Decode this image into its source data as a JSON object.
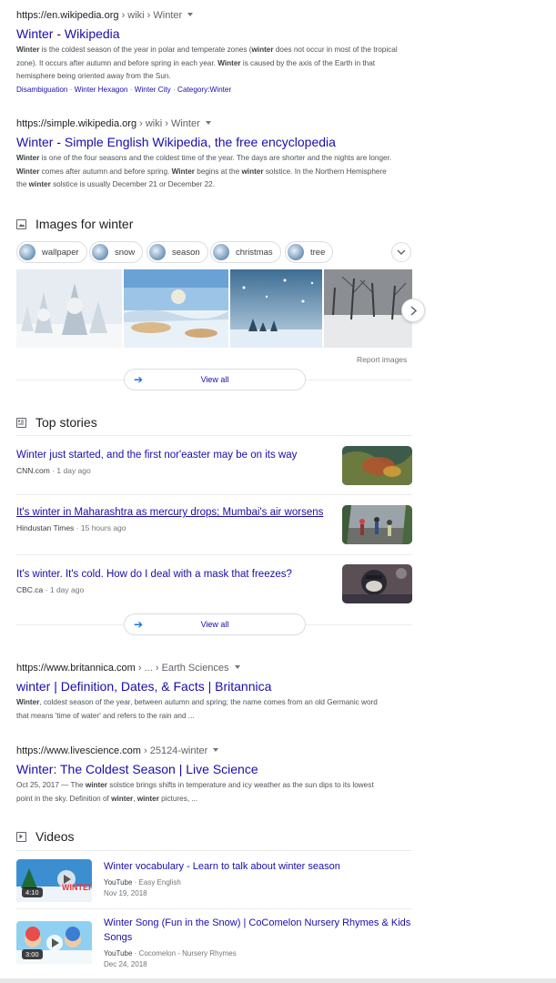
{
  "results": [
    {
      "domain": "https://en.wikipedia.org",
      "path": " › wiki › Winter",
      "title": "Winter - Wikipedia",
      "snippet_html": "<b>Winter</b> is the coldest season of the year in polar and temperate zones (<b>winter</b> does not occur in most of the tropical zone). It occurs after autumn and before spring in each year. <b>Winter</b> is caused by the axis of the Earth in that hemisphere being oriented away from the Sun.",
      "sitelinks": [
        "Disambiguation",
        "Winter Hexagon",
        "Winter City",
        "Category:Winter"
      ]
    },
    {
      "domain": "https://simple.wikipedia.org",
      "path": " › wiki › Winter",
      "title": "Winter - Simple English Wikipedia, the free encyclopedia",
      "snippet_html": "<b>Winter</b> is one of the four seasons and the coldest time of the year. The days are shorter and the nights are longer. <b>Winter</b> comes after autumn and before spring. <b>Winter</b> begins at the <b>winter</b> solstice. In the Northern Hemisphere the <b>winter</b> solstice is usually December 21 or December 22."
    },
    {
      "domain": "https://www.britannica.com",
      "path": " › ... › Earth Sciences",
      "title": "winter | Definition, Dates, & Facts | Britannica",
      "snippet_html": "<b>Winter</b>, coldest season of the year, between autumn and spring; the name comes from an old Germanic word that means 'time of water' and refers to the rain and ..."
    },
    {
      "domain": "https://www.livescience.com",
      "path": " › 25124-winter",
      "title": "Winter: The Coldest Season | Live Science",
      "snippet_html": "Oct 25, 2017 — The <b>winter</b> solstice brings shifts in temperature and icy weather as the sun dips to its lowest point in the sky. Definition of <b>winter</b>, <b>winter</b> pictures, ..."
    }
  ],
  "images_section": {
    "heading": "Images for winter",
    "chips": [
      "wallpaper",
      "snow",
      "season",
      "christmas",
      "tree"
    ],
    "report_label": "Report images",
    "view_all_label": "View all"
  },
  "top_stories": {
    "heading": "Top stories",
    "stories": [
      {
        "title": "Winter just started, and the first nor'easter may be on its way",
        "source": "CNN.com",
        "age": "1 day ago"
      },
      {
        "title": "It's winter in Maharashtra as mercury drops; Mumbai's air worsens",
        "source": "Hindustan Times",
        "age": "15 hours ago"
      },
      {
        "title": "It's winter. It's cold. How do I deal with a mask that freezes?",
        "source": "CBC.ca",
        "age": "1 day ago"
      }
    ],
    "view_all_label": "View all"
  },
  "videos": {
    "heading": "Videos",
    "items": [
      {
        "title": "Winter vocabulary - Learn to talk about winter season",
        "platform": "YouTube",
        "channel": "Easy English",
        "date": "Nov 19, 2018",
        "duration": "4:10"
      },
      {
        "title": "Winter Song (Fun in the Snow) | CoComelon Nursery Rhymes & Kids Songs",
        "platform": "YouTube",
        "channel": "Cocomelon - Nursery Rhymes",
        "date": "Dec 24, 2018",
        "duration": "3:00"
      }
    ]
  },
  "colors": {
    "link": "#1a0dab",
    "text": "#202124",
    "muted": "#70757a",
    "accent": "#1a73e8"
  }
}
